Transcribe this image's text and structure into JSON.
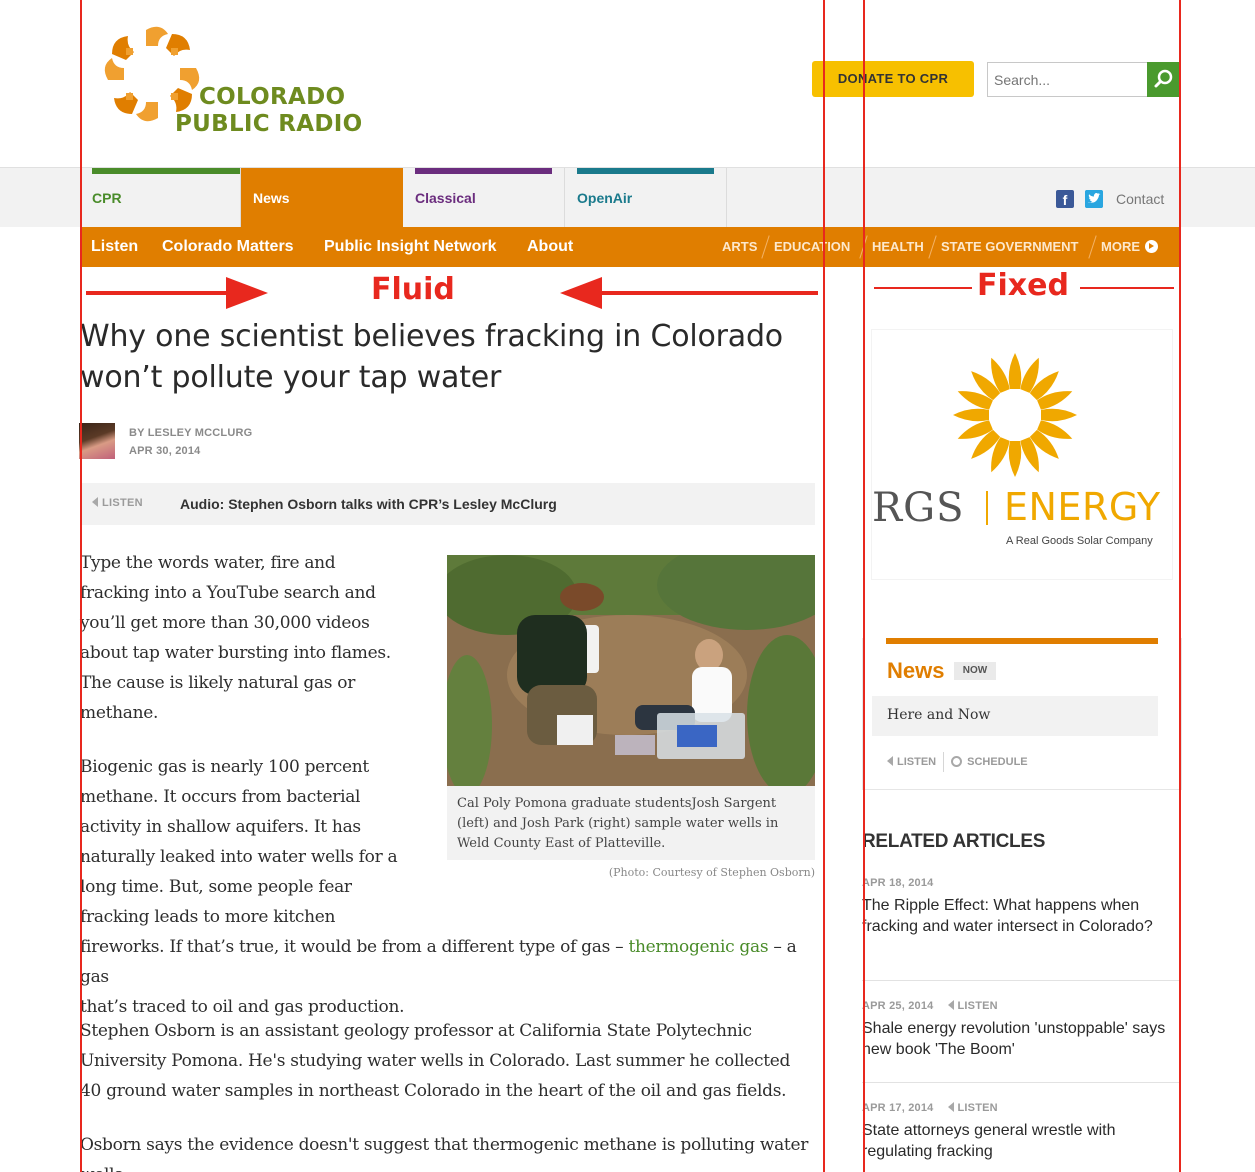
{
  "site": {
    "logo_line1": "COLORADO",
    "logo_line2": "PUBLIC RADIO",
    "donate_label": "DONATE TO CPR",
    "search_placeholder": "Search..."
  },
  "tabs": [
    {
      "label": "CPR",
      "color": "#4a8c2a"
    },
    {
      "label": "News",
      "color": "#e07e00"
    },
    {
      "label": "Classical",
      "color": "#6b2d7e"
    },
    {
      "label": "OpenAir",
      "color": "#1a7a8c"
    }
  ],
  "social": {
    "facebook_icon": "f",
    "contact_label": "Contact"
  },
  "nav": {
    "left": [
      "Listen",
      "Colorado Matters",
      "Public Insight Network",
      "About"
    ],
    "right": [
      "ARTS",
      "EDUCATION",
      "HEALTH",
      "STATE GOVERNMENT",
      "MORE"
    ]
  },
  "annotations": {
    "fluid": "Fluid",
    "fixed": "Fixed"
  },
  "article": {
    "headline": "Why one scientist believes fracking in Colorado won’t pollute your tap water",
    "byline": "BY LESLEY MCCLURG",
    "date": "APR 30, 2014",
    "listen_label": "LISTEN",
    "audio_title": "Audio: Stephen Osborn talks with CPR’s Lesley McClurg",
    "p1": "Type the words water, fire and fracking into a YouTube search and you’ll get more than 30,000 videos about tap water bursting into flames. The cause is likely natural gas or methane.",
    "p2_wrap": "Biogenic gas is nearly 100 percent methane. It occurs from bacterial activity in shallow aquifers. It has naturally leaked into water wells for a long time. But, some people fear fracking leads to more kitchen",
    "p2_full_before": "fireworks. If that’s true, it would be from a different type of gas –",
    "p2_link": "thermogenic gas",
    "p2_after": "– a gas",
    "p2_end": "that’s traced to oil and gas production.",
    "p3": "Stephen Osborn is an assistant geology professor at California State Polytechnic University Pomona. He's studying water wells in Colorado. Last summer he collected 40 ground water samples in northeast Colorado in the heart of the oil and gas fields.",
    "p4": "Osborn says the evidence doesn't suggest that thermogenic methane is polluting water wells.",
    "caption": "Cal Poly Pomona graduate studentsJosh Sargent (left) and Josh Park (right) sample water wells in Weld County East of  Platteville.",
    "credit": "(Photo: Courtesy of Stephen Osborn)"
  },
  "ad": {
    "brand_left": "RGS",
    "brand_right": "ENERGY",
    "tagline": "A Real Goods Solar Company"
  },
  "news_now": {
    "title": "News",
    "badge": "NOW",
    "show": "Here and Now",
    "listen": "LISTEN",
    "schedule": "SCHEDULE"
  },
  "related": {
    "heading": "RELATED ARTICLES",
    "items": [
      {
        "date": "APR 18, 2014",
        "listen": "",
        "title": "The Ripple Effect: What happens when fracking and water intersect in Colorado?"
      },
      {
        "date": "APR 25, 2014",
        "listen": "LISTEN",
        "title": "Shale energy revolution 'unstoppable' says new book 'The Boom'"
      },
      {
        "date": "APR 17, 2014",
        "listen": "LISTEN",
        "title": "State attorneys general wrestle with regulating fracking"
      }
    ]
  },
  "colors": {
    "brand_orange": "#e07e00",
    "donate_yellow": "#f7c000",
    "annotation_red": "#e8281e"
  }
}
